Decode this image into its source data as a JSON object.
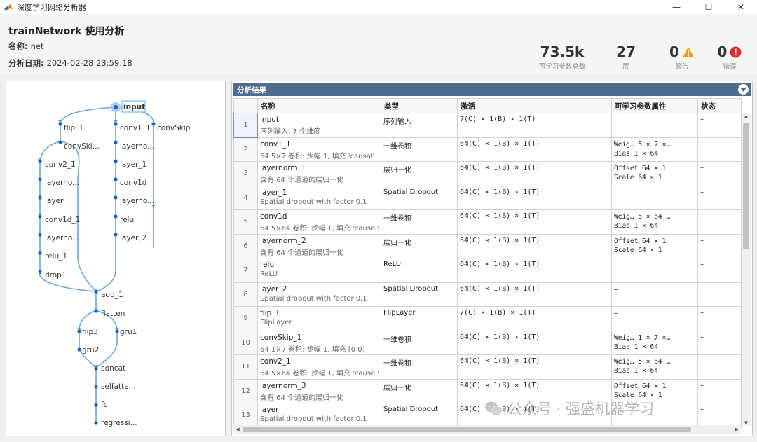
{
  "window": {
    "title": "深度学习网络分析器",
    "min": "—",
    "max": "☐",
    "close": "✕"
  },
  "header": {
    "title": "trainNetwork 使用分析",
    "name_label": "名称:",
    "name_value": "net",
    "date_label": "分析日期:",
    "date_value": "2024-02-28 23:59:18",
    "stats": [
      {
        "value": "73.5k",
        "label": "可学习参数总数"
      },
      {
        "value": "27",
        "label": "层"
      },
      {
        "value": "0",
        "label": "警告"
      },
      {
        "value": "0",
        "label": "错误"
      }
    ]
  },
  "colors": {
    "accent": "#4d6c8e",
    "node": "#1565c0",
    "edge": "#6fa6d8",
    "warning": "#f0a000",
    "error": "#d32f2f"
  },
  "graph": {
    "nodes": [
      {
        "id": "input",
        "label": "input"
      },
      {
        "id": "flip_1",
        "label": "flip_1"
      },
      {
        "id": "conv1_1",
        "label": "conv1_1"
      },
      {
        "id": "convSkip",
        "label": "convSkip"
      },
      {
        "id": "convSki",
        "label": "convSki..."
      },
      {
        "id": "layerno1",
        "label": "layerno..."
      },
      {
        "id": "conv2_1",
        "label": "conv2_1"
      },
      {
        "id": "layer_1",
        "label": "layer_1"
      },
      {
        "id": "layerno2",
        "label": "layerno..."
      },
      {
        "id": "conv1d",
        "label": "conv1d"
      },
      {
        "id": "layer",
        "label": "layer"
      },
      {
        "id": "layerno3",
        "label": "layerno..."
      },
      {
        "id": "conv1d_1",
        "label": "conv1d_1"
      },
      {
        "id": "relu",
        "label": "relu"
      },
      {
        "id": "layerno4",
        "label": "layerno..."
      },
      {
        "id": "layer_2",
        "label": "layer_2"
      },
      {
        "id": "relu_1",
        "label": "relu_1"
      },
      {
        "id": "drop1",
        "label": "drop1"
      },
      {
        "id": "add_1",
        "label": "add_1"
      },
      {
        "id": "flatten",
        "label": "flatten"
      },
      {
        "id": "flip3",
        "label": "flip3"
      },
      {
        "id": "gru1",
        "label": "gru1"
      },
      {
        "id": "gru2",
        "label": "gru2"
      },
      {
        "id": "concat",
        "label": "concat"
      },
      {
        "id": "selfatte",
        "label": "selfatte..."
      },
      {
        "id": "fc",
        "label": "fc"
      },
      {
        "id": "regressi",
        "label": "regressi..."
      }
    ]
  },
  "results": {
    "title": "分析结果",
    "columns": [
      "名称",
      "类型",
      "激活",
      "可学习参数属性",
      "状态"
    ],
    "rows": [
      {
        "idx": "1",
        "name": "input",
        "desc": "序列输入: 7 个维度",
        "type": "序列输入",
        "act": "7(C) × 1(B) × 1(T)",
        "p1": "–",
        "p2": "",
        "status": "–"
      },
      {
        "idx": "2",
        "name": "conv1_1",
        "desc": "64 5×7 卷积: 步幅 1, 填充 'causal'",
        "type": "一维卷积",
        "act": "64(C) × 1(B) × 1(T)",
        "p1": "Weig…  5 × 7 ×…",
        "p2": "Bias   1 × 64",
        "status": "–"
      },
      {
        "idx": "3",
        "name": "layernorm_1",
        "desc": "含有 64 个通道的层归一化",
        "type": "层归一化",
        "act": "64(C) × 1(B) × 1(T)",
        "p1": "Offset  64 × 1",
        "p2": "Scale   64 × 1",
        "status": "–"
      },
      {
        "idx": "4",
        "name": "layer_1",
        "desc": "Spatial dropout with factor 0.1",
        "type": "Spatial Dropout",
        "act": "64(C) × 1(B) × 1(T)",
        "p1": "–",
        "p2": "",
        "status": "–"
      },
      {
        "idx": "5",
        "name": "conv1d",
        "desc": "64 5×64 卷积: 步幅 1, 填充 'causal'",
        "type": "一维卷积",
        "act": "64(C) × 1(B) × 1(T)",
        "p1": "Weig…  5 × 64 …",
        "p2": "Bias   1 × 64",
        "status": "–"
      },
      {
        "idx": "6",
        "name": "layernorm_2",
        "desc": "含有 64 个通道的层归一化",
        "type": "层归一化",
        "act": "64(C) × 1(B) × 1(T)",
        "p1": "Offset  64 × 1",
        "p2": "Scale   64 × 1",
        "status": "–"
      },
      {
        "idx": "7",
        "name": "relu",
        "desc": "ReLU",
        "type": "ReLU",
        "act": "64(C) × 1(B) × 1(T)",
        "p1": "–",
        "p2": "",
        "status": "–"
      },
      {
        "idx": "8",
        "name": "layer_2",
        "desc": "Spatial dropout with factor 0.1",
        "type": "Spatial Dropout",
        "act": "64(C) × 1(B) × 1(T)",
        "p1": "–",
        "p2": "",
        "status": "–"
      },
      {
        "idx": "9",
        "name": "flip_1",
        "desc": "FlipLayer",
        "type": "FlipLayer",
        "act": "7(C) × 1(B) × 1(T)",
        "p1": "–",
        "p2": "",
        "status": "–"
      },
      {
        "idx": "10",
        "name": "convSkip_1",
        "desc": "64 1×7 卷积: 步幅 1, 填充 [0 0]",
        "type": "一维卷积",
        "act": "64(C) × 1(B) × 1(T)",
        "p1": "Weig…  1 × 7 ×…",
        "p2": "Bias   1 × 64",
        "status": "–"
      },
      {
        "idx": "11",
        "name": "conv2_1",
        "desc": "64 5×64 卷积: 步幅 1, 填充 'causal'",
        "type": "一维卷积",
        "act": "64(C) × 1(B) × 1(T)",
        "p1": "Weig…  5 × 64 …",
        "p2": "Bias   1 × 64",
        "status": "–"
      },
      {
        "idx": "12",
        "name": "layernorm_3",
        "desc": "含有 64 个通道的层归一化",
        "type": "层归一化",
        "act": "64(C) × 1(B) × 1(T)",
        "p1": "Offset  64 × 1",
        "p2": "Scale   64 × 1",
        "status": "–"
      },
      {
        "idx": "13",
        "name": "layer",
        "desc": "Spatial dropout with factor 0.1",
        "type": "Spatial Dropout",
        "act": "64(C) × 1(B) × 1(T)",
        "p1": "–",
        "p2": "",
        "status": "–"
      }
    ]
  },
  "watermark": {
    "text": "公众号 · 强盛机器学习"
  }
}
